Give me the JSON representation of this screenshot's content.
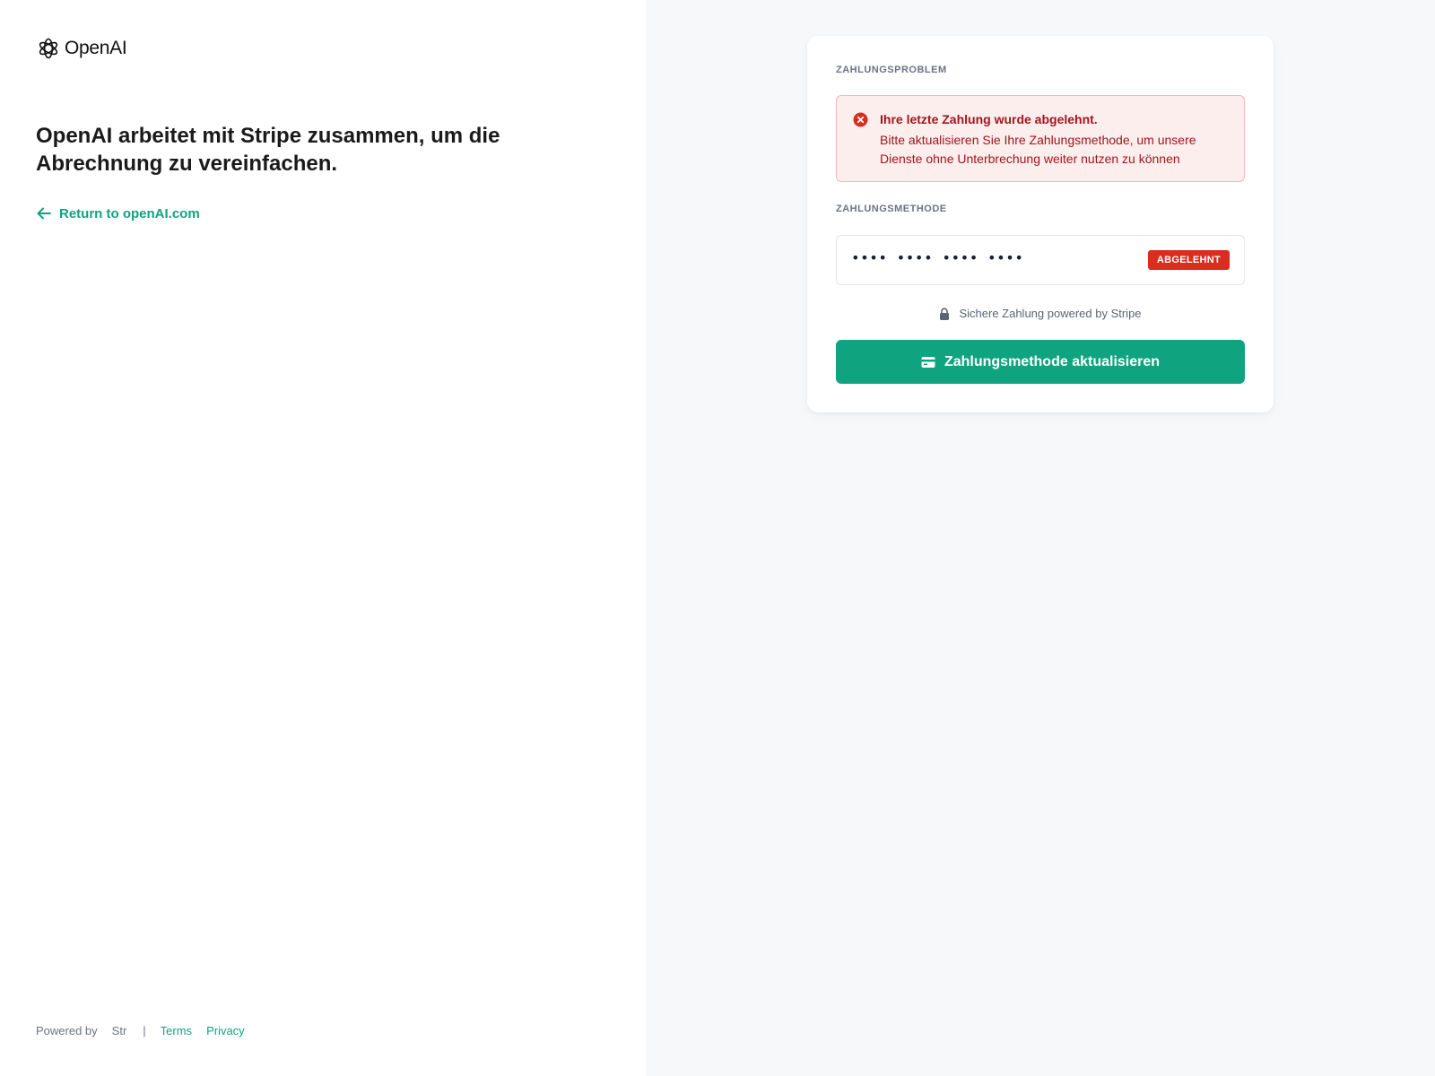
{
  "brand": {
    "name": "OpenAI",
    "accent_color": "#10a37f",
    "error_color": "#d92d20"
  },
  "left": {
    "headline": "OpenAI arbeitet mit Stripe zusammen, um die Abrechnung zu vereinfachen.",
    "return_link": "Return to openAI.com"
  },
  "footer": {
    "powered_by": "Powered by",
    "provider": "Str",
    "separator": "|",
    "terms": "Terms",
    "privacy": "Privacy"
  },
  "card": {
    "problem_label": "ZAHLUNGSPROBLEM",
    "alert_title": "Ihre letzte Zahlung wurde abgelehnt.",
    "alert_body": "Bitte aktualisieren Sie Ihre Zahlungsmethode, um unsere Dienste ohne Unterbrechung weiter nutzen zu können",
    "method_label": "ZAHLUNGSMETHODE",
    "card_number": "•••• •••• •••• ••••",
    "status_badge": "ABGELEHNT",
    "secure_note": "Sichere Zahlung powered by Stripe",
    "update_button": "Zahlungsmethode aktualisieren"
  },
  "icons": {
    "logo": "openai-logo-icon",
    "back": "arrow-left-icon",
    "alert": "error-circle-icon",
    "lock": "lock-icon",
    "card": "credit-card-icon"
  }
}
